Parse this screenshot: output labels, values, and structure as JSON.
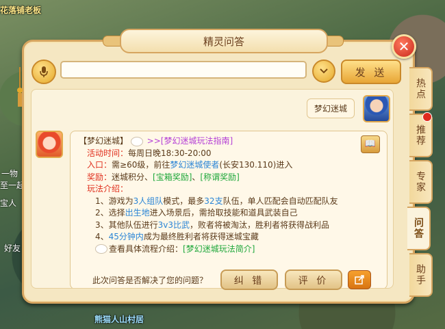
{
  "background": {
    "top_left_text": "花落铺老板",
    "side_texts": [
      "一物",
      "至一起",
      "宝人",
      "好友"
    ],
    "bottom_text": "熊猫人山村居"
  },
  "dialog": {
    "title": "精灵问答",
    "close_icon": "close-x-icon"
  },
  "input_row": {
    "mic_icon": "microphone-icon",
    "search_value": "",
    "dropdown_icon": "chevron-down-icon",
    "send_label": "发 送"
  },
  "chat": {
    "player_message": "梦幻迷城",
    "npc": {
      "line1_prefix": "【梦幻迷城】",
      "line1_link": ">>[梦幻迷城玩法指南]",
      "time_label": "活动时间：",
      "time_value": "每周日晚18:30-20:00",
      "entry_label": "入口：",
      "entry_text_a": "需≥60级，前往",
      "entry_npc": "梦幻迷城使者",
      "entry_text_b": "(长安130.110)进入",
      "reward_label": "奖励：",
      "reward_text": "迷城积分、",
      "reward_link1": "[宝箱奖励]",
      "reward_sep": "、",
      "reward_link2": "[称谓奖励]",
      "intro_label": "玩法介绍：",
      "rule1_a": "1、游戏为",
      "rule1_b": "3人组队",
      "rule1_c": "模式，最多",
      "rule1_d": "32支",
      "rule1_e": "队伍，单人匹配会自动匹配队友",
      "rule2_a": "2、选择",
      "rule2_b": "出生地",
      "rule2_c": "进入场景后，需拾取技能和道具武装自己",
      "rule3_a": "3、其他队伍进行",
      "rule3_b": "3v3比武",
      "rule3_c": "，败者将被淘汰，胜利者将获得战利品",
      "rule4_a": "4、",
      "rule4_b": "45分钟内",
      "rule4_c": "成为最终胜利者将获得迷城宝藏",
      "footer_a": "查看具体流程介绍：",
      "footer_link": "[梦幻迷城玩法简介]"
    }
  },
  "bottom_row": {
    "question": "此次问答是否解决了您的问题？",
    "btn_correct": "纠 错",
    "btn_rate": "评 价",
    "share_icon": "share-icon"
  },
  "tabs": [
    {
      "label": "热点"
    },
    {
      "label": "推荐"
    },
    {
      "label": "专家"
    },
    {
      "label": "问答"
    },
    {
      "label": "助手"
    }
  ],
  "colors": {
    "accent_red": "#e0301e",
    "link_blue": "#2a85d6",
    "link_green": "#1ea73a",
    "link_purple": "#b43fd6",
    "panel_bg": "#f5e7c2"
  }
}
